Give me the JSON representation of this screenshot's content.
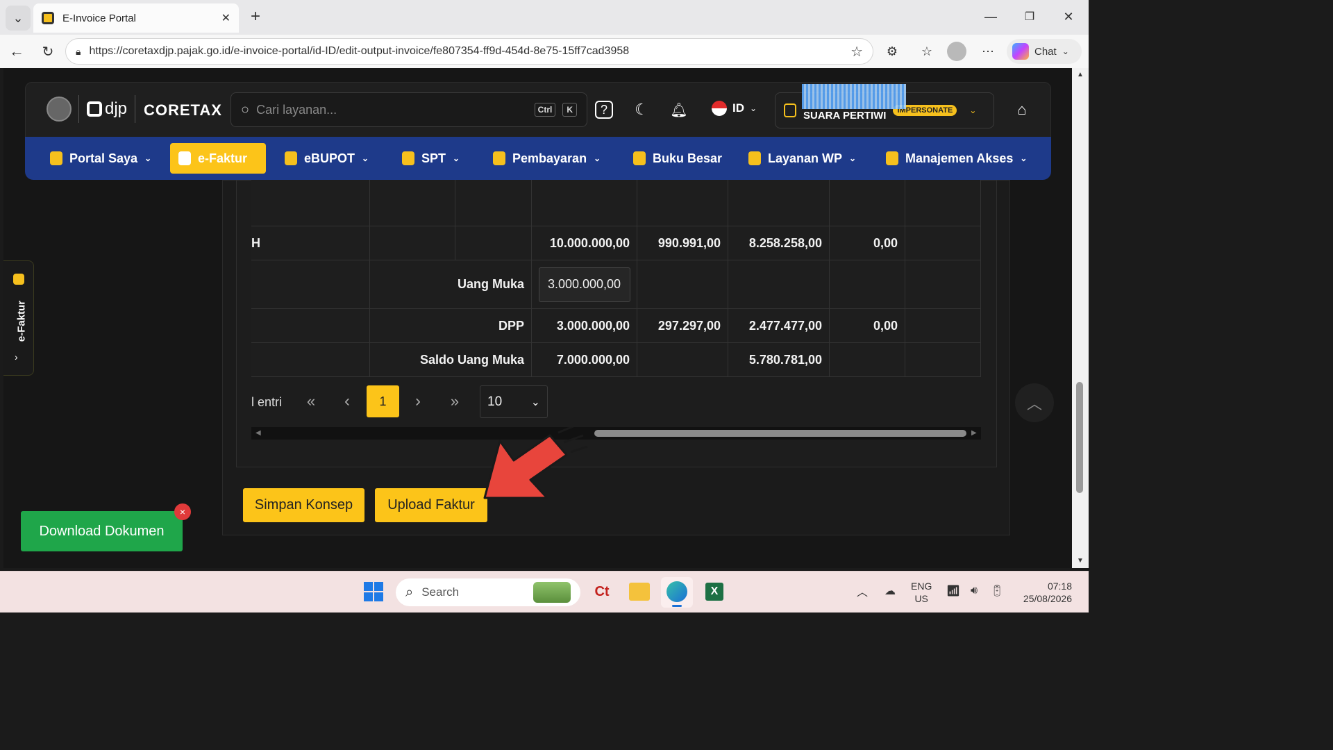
{
  "browser": {
    "tab_title": "E-Invoice Portal",
    "url": "https://coretaxdjp.pajak.go.id/e-invoice-portal/id-ID/edit-output-invoice/fe807354-ff9d-454d-8e75-15ff7cad3958",
    "chat_label": "Chat"
  },
  "header": {
    "brand_djp": "djp",
    "brand_coretax": "CORETAX",
    "search_placeholder": "Cari layanan...",
    "kbd_ctrl": "Ctrl",
    "kbd_k": "K",
    "language": "ID",
    "user_name": "SUARA PERTIWI",
    "impersonate_badge": "IMPERSONATE"
  },
  "menu": [
    {
      "label": "Portal Saya"
    },
    {
      "label": "e-Faktur"
    },
    {
      "label": "eBUPOT"
    },
    {
      "label": "SPT"
    },
    {
      "label": "Pembayaran"
    },
    {
      "label": "Buku Besar"
    },
    {
      "label": "Layanan WP"
    },
    {
      "label": "Manajemen Akses"
    }
  ],
  "side_tab": {
    "label": "e-Faktur"
  },
  "table": {
    "total_row": {
      "fragment": "H",
      "c1": "10.000.000,00",
      "c2": "990.991,00",
      "c3": "8.258.258,00",
      "c4": "0,00"
    },
    "uang_muka_row": {
      "label": "Uang Muka",
      "value": "3.000.000,00"
    },
    "dpp_row": {
      "label": "DPP",
      "c1": "3.000.000,00",
      "c2": "297.297,00",
      "c3": "2.477.477,00",
      "c4": "0,00"
    },
    "saldo_row": {
      "label": "Saldo Uang Muka",
      "c1": "7.000.000,00",
      "c3": "5.780.781,00"
    }
  },
  "pagination": {
    "entries_fragment": "l entri",
    "first": "«",
    "prev": "‹",
    "page": "1",
    "next": "›",
    "last": "»",
    "page_size": "10"
  },
  "actions": {
    "save_draft": "Simpan Konsep",
    "upload": "Upload Faktur",
    "download": "Download Dokumen",
    "close_badge": "×"
  },
  "taskbar": {
    "search_placeholder": "Search",
    "lang_line1": "ENG",
    "lang_line2": "US",
    "time": "07:18",
    "date": "25/08/2026"
  },
  "colors": {
    "accent_yellow": "#fcc419",
    "menu_blue": "#1e3a8a",
    "download_green": "#1fa64a",
    "annotation_arrow": "#e8453c"
  }
}
